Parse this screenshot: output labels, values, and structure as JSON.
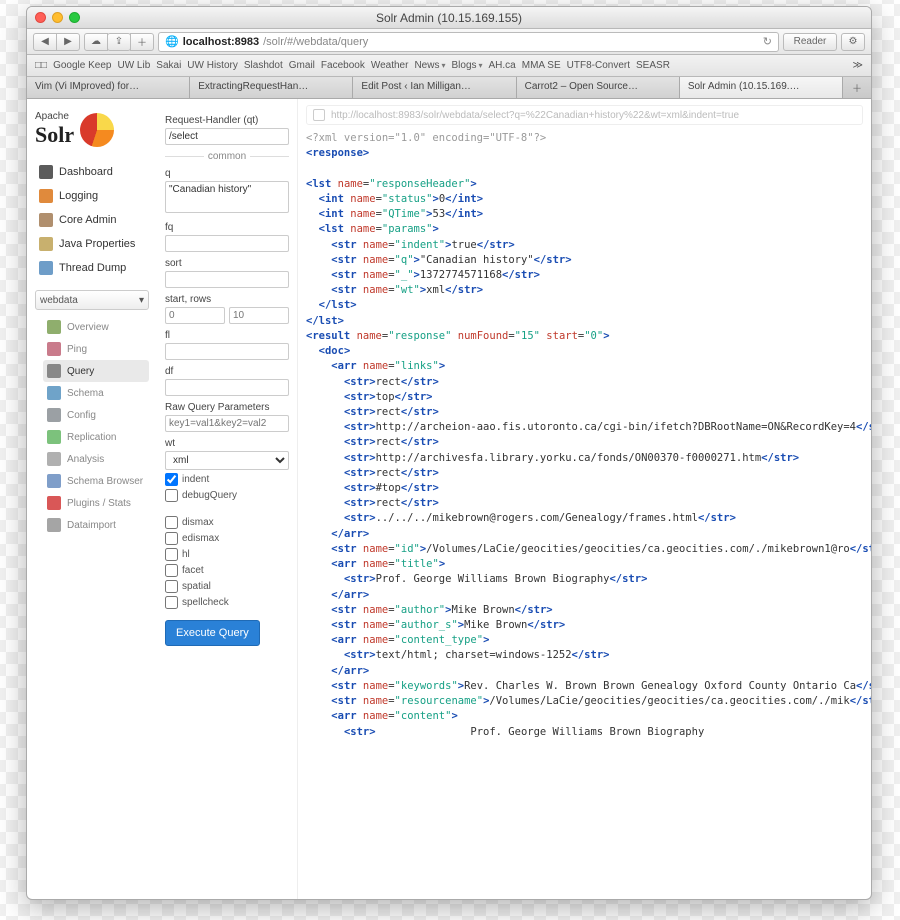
{
  "window": {
    "title": "Solr Admin (10.15.169.155)"
  },
  "url": {
    "host": "localhost:8983",
    "path": "/solr/#/webdata/query",
    "reader": "Reader"
  },
  "bookmarks": [
    "□□",
    "Google Keep",
    "UW Lib",
    "Sakai",
    "UW History",
    "Slashdot",
    "Gmail",
    "Facebook",
    "Weather",
    "News",
    "Blogs",
    "AH.ca",
    "MMA SE",
    "UTF8-Convert",
    "SEASR"
  ],
  "browser_tabs": [
    {
      "label": "Vim (Vi IMproved) for…"
    },
    {
      "label": "ExtractingRequestHan…"
    },
    {
      "label": "Edit Post ‹ Ian Milligan…"
    },
    {
      "label": "Carrot2 – Open Source…"
    },
    {
      "label": "Solr Admin (10.15.169.…",
      "active": true
    }
  ],
  "logo": {
    "top": "Apache",
    "main": "Solr"
  },
  "sidebar_main": [
    {
      "label": "Dashboard",
      "icon": "#5b5b5b"
    },
    {
      "label": "Logging",
      "icon": "#e08a3c"
    },
    {
      "label": "Core Admin",
      "icon": "#b08f6e"
    },
    {
      "label": "Java Properties",
      "icon": "#c8b06e"
    },
    {
      "label": "Thread Dump",
      "icon": "#6e9dc8"
    }
  ],
  "core_name": "webdata",
  "sidebar_core": [
    {
      "label": "Overview",
      "icon": "#8fae6d"
    },
    {
      "label": "Ping",
      "icon": "#c97b8b"
    },
    {
      "label": "Query",
      "icon": "#888",
      "active": true
    },
    {
      "label": "Schema",
      "icon": "#6fa3c9"
    },
    {
      "label": "Config",
      "icon": "#9ba0a4"
    },
    {
      "label": "Replication",
      "icon": "#7cc27c"
    },
    {
      "label": "Analysis",
      "icon": "#b0b0b0"
    },
    {
      "label": "Schema Browser",
      "icon": "#7f9ec9"
    },
    {
      "label": "Plugins / Stats",
      "icon": "#d95757"
    },
    {
      "label": "Dataimport",
      "icon": "#a5a5a5"
    }
  ],
  "form": {
    "qt_label": "Request-Handler (qt)",
    "qt_value": "/select",
    "common": "common",
    "q_label": "q",
    "q_value": "\"Canadian history\"",
    "fq_label": "fq",
    "fq_value": "",
    "sort_label": "sort",
    "sort_value": "",
    "startrows_label": "start, rows",
    "start_ph": "0",
    "rows_ph": "10",
    "fl_label": "fl",
    "fl_value": "",
    "df_label": "df",
    "df_value": "",
    "raw_label": "Raw Query Parameters",
    "raw_ph": "key1=val1&key2=val2",
    "wt_label": "wt",
    "wt_value": "xml",
    "indent": "indent",
    "debugQuery": "debugQuery",
    "opts": [
      "dismax",
      "edismax",
      "hl",
      "facet",
      "spatial",
      "spellcheck"
    ],
    "submit": "Execute Query"
  },
  "response_url": "http://localhost:8983/solr/webdata/select?q=%22Canadian+history%22&wt=xml&indent=true",
  "xml": {
    "decl": "<?xml version=\"1.0\" encoding=\"UTF-8\"?>",
    "status": "0",
    "qtime": "53",
    "indent": "true",
    "q": "\"Canadian history\"",
    "underscore": "1372774571168",
    "wt": "xml",
    "numFound": "15",
    "startAttr": "0",
    "links": [
      "rect",
      "top",
      "rect",
      "http://archeion-aao.fis.utoronto.ca/cgi-bin/ifetch?DBRootName=ON&RecordKey=4",
      "rect",
      "http://archivesfa.library.yorku.ca/fonds/ON00370-f0000271.htm",
      "rect",
      "#top",
      "rect",
      "../../../mikebrown@rogers.com/Genealogy/frames.html"
    ],
    "id": "/Volumes/LaCie/geocities/geocities/ca.geocities.com/./mikebrown1@ro",
    "title": "Prof. George Williams Brown Biography",
    "author": "Mike Brown",
    "author_s": "Mike Brown",
    "content_type": "text/html; charset=windows-1252",
    "keywords": "Rev. Charles W. Brown Brown Genealogy Oxford County Ontario Ca",
    "resourcename": "/Volumes/LaCie/geocities/geocities/ca.geocities.com/./mik",
    "content_str": "Prof. George Williams Brown Biography"
  }
}
